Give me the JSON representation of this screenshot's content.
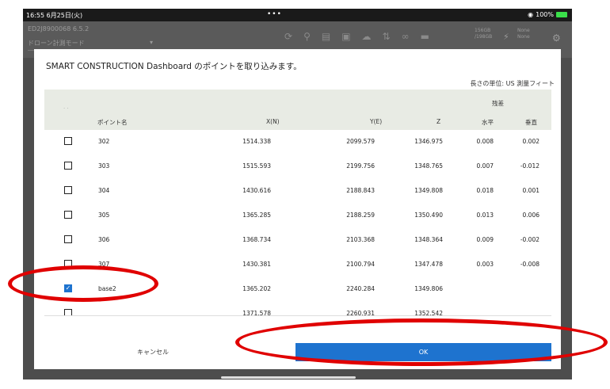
{
  "status_bar": {
    "time": "16:55 6月25日(火)",
    "dots": "•••",
    "battery": "100%"
  },
  "app_bar": {
    "device": "ED2J8900068  6.5.2",
    "mode": "ドローン計測モード",
    "storage_line1": "156GB",
    "storage_line2": "/198GB",
    "none_line1": "None",
    "none_line2": "None"
  },
  "dialog": {
    "title": "SMART CONSTRUCTION Dashboard のポイントを取り込みます。",
    "unit_label": "長さの単位: US 測量フィート",
    "header_residual": "残差",
    "headers": {
      "name": "ポイント名",
      "x": "X(N)",
      "y": "Y(E)",
      "z": "Z",
      "horizontal": "水平",
      "vertical": "垂直"
    },
    "rows": [
      {
        "name": "302",
        "x": "1514.338",
        "y": "2099.579",
        "z": "1346.975",
        "h": "0.008",
        "v": "0.002",
        "checked": false
      },
      {
        "name": "303",
        "x": "1515.593",
        "y": "2199.756",
        "z": "1348.765",
        "h": "0.007",
        "v": "-0.012",
        "checked": false
      },
      {
        "name": "304",
        "x": "1430.616",
        "y": "2188.843",
        "z": "1349.808",
        "h": "0.018",
        "v": "0.001",
        "checked": false
      },
      {
        "name": "305",
        "x": "1365.285",
        "y": "2188.259",
        "z": "1350.490",
        "h": "0.013",
        "v": "0.006",
        "checked": false
      },
      {
        "name": "306",
        "x": "1368.734",
        "y": "2103.368",
        "z": "1348.364",
        "h": "0.009",
        "v": "-0.002",
        "checked": false
      },
      {
        "name": "307",
        "x": "1430.381",
        "y": "2100.794",
        "z": "1347.478",
        "h": "0.003",
        "v": "-0.008",
        "checked": false
      },
      {
        "name": "base2",
        "x": "1365.202",
        "y": "2240.284",
        "z": "1349.806",
        "h": "",
        "v": "",
        "checked": true
      },
      {
        "name": "",
        "x": "1371.578",
        "y": "2260.931",
        "z": "1352.542",
        "h": "",
        "v": "",
        "checked": false
      }
    ],
    "cancel_label": "キャンセル",
    "ok_label": "OK"
  },
  "colors": {
    "accent": "#1e73cf",
    "annotation": "#e00000",
    "header_bg": "#e8ebe4"
  }
}
